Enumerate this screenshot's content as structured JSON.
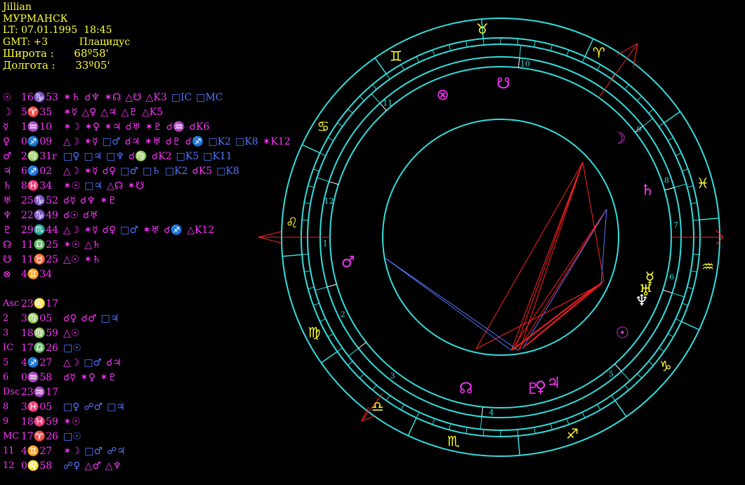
{
  "header": {
    "name": "Jillian",
    "city": "МУРМАНСК",
    "local_time": "LT: 07.01.1995  18:45",
    "gmt": "GMT: +3",
    "house_system": "Плацидус",
    "latitude_label": "Широта :",
    "latitude_value": "68º58'",
    "longitude_label": "Долгота :",
    "longitude_value": "33º05'"
  },
  "colors": {
    "yellow": "#ffff33",
    "magenta": "#ff33ff",
    "cyan": "#33dddd",
    "blue": "#5577ff",
    "red": "#ff2222",
    "white": "#ffffff"
  },
  "planets": [
    {
      "symbol": "☉",
      "position": "16♑53",
      "aspects": [
        {
          "t": "✶♄",
          "c": "#ff33ff"
        },
        {
          "t": "☌♆",
          "c": "#ff33ff"
        },
        {
          "t": "✶☊",
          "c": "#ff33ff"
        },
        {
          "t": "△☋",
          "c": "#ff33ff"
        },
        {
          "t": "△K3",
          "c": "#ff33ff"
        },
        {
          "t": "□IC",
          "c": "#5577ff"
        },
        {
          "t": "□MC",
          "c": "#5577ff"
        }
      ]
    },
    {
      "symbol": "☽",
      "position": "5♈35",
      "aspects": [
        {
          "t": "✶☿",
          "c": "#ff33ff"
        },
        {
          "t": "△♀",
          "c": "#ff33ff"
        },
        {
          "t": "△♃",
          "c": "#ff33ff"
        },
        {
          "t": "△♇",
          "c": "#ff33ff"
        },
        {
          "t": "△K5",
          "c": "#ff33ff"
        }
      ]
    },
    {
      "symbol": "☿",
      "position": "1♒10",
      "aspects": [
        {
          "t": "✶☽",
          "c": "#ff33ff"
        },
        {
          "t": "✶♀",
          "c": "#ff33ff"
        },
        {
          "t": "✶♃",
          "c": "#ff33ff"
        },
        {
          "t": "☌♅",
          "c": "#ff33ff"
        },
        {
          "t": "✶♇",
          "c": "#ff33ff"
        },
        {
          "t": "☌♒",
          "c": "#ff33ff"
        },
        {
          "t": "☌K6",
          "c": "#ff33ff"
        }
      ]
    },
    {
      "symbol": "♀",
      "position": "0♐09",
      "aspects": [
        {
          "t": "△☽",
          "c": "#ff33ff"
        },
        {
          "t": "✶☿",
          "c": "#ff33ff"
        },
        {
          "t": "□♂",
          "c": "#5577ff"
        },
        {
          "t": "☌♃",
          "c": "#ff33ff"
        },
        {
          "t": "✶♅",
          "c": "#ff33ff"
        },
        {
          "t": "☌♇",
          "c": "#ff33ff"
        },
        {
          "t": "☌♐",
          "c": "#ff33ff"
        },
        {
          "t": "□K2",
          "c": "#5577ff"
        },
        {
          "t": "□K8",
          "c": "#5577ff"
        },
        {
          "t": "✶K12",
          "c": "#ff33ff"
        }
      ]
    },
    {
      "symbol": "♂",
      "position": "2♍31r",
      "aspects": [
        {
          "t": "□♀",
          "c": "#5577ff"
        },
        {
          "t": "□♃",
          "c": "#5577ff"
        },
        {
          "t": "□♆",
          "c": "#5577ff"
        },
        {
          "t": "☌♍",
          "c": "#ff33ff"
        },
        {
          "t": "☌K2",
          "c": "#ff33ff"
        },
        {
          "t": "□K5",
          "c": "#5577ff"
        },
        {
          "t": "□K11",
          "c": "#5577ff"
        }
      ]
    },
    {
      "symbol": "♃",
      "position": "6♐02",
      "aspects": [
        {
          "t": "△☽",
          "c": "#ff33ff"
        },
        {
          "t": "✶☿",
          "c": "#ff33ff"
        },
        {
          "t": "☌♀",
          "c": "#ff33ff"
        },
        {
          "t": "□♂",
          "c": "#5577ff"
        },
        {
          "t": "□♄",
          "c": "#5577ff"
        },
        {
          "t": "□K2",
          "c": "#5577ff"
        },
        {
          "t": "☌K5",
          "c": "#ff33ff"
        },
        {
          "t": "□K8",
          "c": "#5577ff"
        }
      ]
    },
    {
      "symbol": "♄",
      "position": "8♓34",
      "aspects": [
        {
          "t": "✶☉",
          "c": "#ff33ff"
        },
        {
          "t": "□♃",
          "c": "#5577ff"
        },
        {
          "t": "△☊",
          "c": "#ff33ff"
        },
        {
          "t": "✶☋",
          "c": "#ff33ff"
        }
      ]
    },
    {
      "symbol": "♅",
      "position": "25♑52",
      "aspects": [
        {
          "t": "☌☿",
          "c": "#ff33ff"
        },
        {
          "t": "☌♆",
          "c": "#ff33ff"
        },
        {
          "t": "✶♇",
          "c": "#ff33ff"
        }
      ]
    },
    {
      "symbol": "♆",
      "position": "22♑49",
      "aspects": [
        {
          "t": "☌☉",
          "c": "#ff33ff"
        },
        {
          "t": "☌♅",
          "c": "#ff33ff"
        }
      ]
    },
    {
      "symbol": "♇",
      "position": "29♏44",
      "aspects": [
        {
          "t": "△☽",
          "c": "#ff33ff"
        },
        {
          "t": "✶☿",
          "c": "#ff33ff"
        },
        {
          "t": "☌♀",
          "c": "#ff33ff"
        },
        {
          "t": "□♂",
          "c": "#5577ff"
        },
        {
          "t": "✶♅",
          "c": "#ff33ff"
        },
        {
          "t": "☌♐",
          "c": "#ff33ff"
        },
        {
          "t": "△K12",
          "c": "#ff33ff"
        }
      ]
    },
    {
      "symbol": "☊",
      "position": "11♎25",
      "aspects": [
        {
          "t": "✶☉",
          "c": "#ff33ff"
        },
        {
          "t": "△♄",
          "c": "#ff33ff"
        }
      ]
    },
    {
      "symbol": "☋",
      "position": "11♉25",
      "aspects": [
        {
          "t": "△☉",
          "c": "#ff33ff"
        },
        {
          "t": "✶♄",
          "c": "#ff33ff"
        }
      ]
    },
    {
      "symbol": "⊗",
      "position": "4♊34",
      "aspects": []
    }
  ],
  "houses": [
    {
      "label": "Asc",
      "position": "23♌17",
      "aspects": []
    },
    {
      "label": "2",
      "position": "3♍05",
      "aspects": [
        {
          "t": "☌♀",
          "c": "#ff33ff"
        },
        {
          "t": "☌♂",
          "c": "#ff33ff"
        },
        {
          "t": "□♃",
          "c": "#5577ff"
        }
      ]
    },
    {
      "label": "3",
      "position": "18♍59",
      "aspects": [
        {
          "t": "△☉",
          "c": "#ff33ff"
        }
      ]
    },
    {
      "label": "IC",
      "position": "17♎26",
      "aspects": [
        {
          "t": "□☉",
          "c": "#5577ff"
        }
      ]
    },
    {
      "label": "5",
      "position": "4♐27",
      "aspects": [
        {
          "t": "△☽",
          "c": "#ff33ff"
        },
        {
          "t": "□♂",
          "c": "#5577ff"
        },
        {
          "t": "☌♃",
          "c": "#ff33ff"
        }
      ]
    },
    {
      "label": "6",
      "position": "0♒58",
      "aspects": [
        {
          "t": "☌☿",
          "c": "#ff33ff"
        },
        {
          "t": "✶♀",
          "c": "#ff33ff"
        },
        {
          "t": "✶♇",
          "c": "#ff33ff"
        }
      ]
    },
    {
      "label": "Dsc",
      "position": "23♒17",
      "aspects": []
    },
    {
      "label": "8",
      "position": "3♓05",
      "aspects": [
        {
          "t": "□♀",
          "c": "#5577ff"
        },
        {
          "t": "☍♂",
          "c": "#5577ff"
        },
        {
          "t": "□♃",
          "c": "#5577ff"
        }
      ]
    },
    {
      "label": "9",
      "position": "18♓59",
      "aspects": [
        {
          "t": "✶☉",
          "c": "#ff33ff"
        }
      ]
    },
    {
      "label": "MC",
      "position": "17♈26",
      "aspects": [
        {
          "t": "□☉",
          "c": "#5577ff"
        }
      ]
    },
    {
      "label": "11",
      "position": "4♊27",
      "aspects": [
        {
          "t": "✶☽",
          "c": "#ff33ff"
        },
        {
          "t": "□♂",
          "c": "#5577ff"
        },
        {
          "t": "☍♃",
          "c": "#5577ff"
        }
      ]
    },
    {
      "label": "12",
      "position": "0♌58",
      "aspects": [
        {
          "t": "☍♀",
          "c": "#5577ff"
        },
        {
          "t": "△♂",
          "c": "#ff33ff"
        },
        {
          "t": "△♆",
          "c": "#ff33ff"
        }
      ]
    }
  ],
  "wheel": {
    "signs": [
      {
        "glyph": "♉",
        "angle": 95
      },
      {
        "glyph": "♊",
        "angle": 120
      },
      {
        "glyph": "♋",
        "angle": 148
      },
      {
        "glyph": "♌",
        "angle": 176
      },
      {
        "glyph": "♍",
        "angle": 207
      },
      {
        "glyph": "♎",
        "angle": 234
      },
      {
        "glyph": "♏",
        "angle": 257
      },
      {
        "glyph": "♐",
        "angle": 290
      },
      {
        "glyph": "♑",
        "angle": 322
      },
      {
        "glyph": "♒",
        "angle": 352
      },
      {
        "glyph": "♓",
        "angle": 15
      },
      {
        "glyph": "♈",
        "angle": 62
      }
    ],
    "house_numbers": [
      {
        "n": "1",
        "angle": 182
      },
      {
        "n": "2",
        "angle": 206
      },
      {
        "n": "3",
        "angle": 232
      },
      {
        "n": "4",
        "angle": 267
      },
      {
        "n": "5",
        "angle": 309
      },
      {
        "n": "6",
        "angle": 347
      },
      {
        "n": "7",
        "angle": 4
      },
      {
        "n": "8",
        "angle": 19
      },
      {
        "n": "9",
        "angle": 38
      },
      {
        "n": "10",
        "angle": 82
      },
      {
        "n": "11",
        "angle": 130
      },
      {
        "n": "12",
        "angle": 168
      }
    ],
    "planets": [
      {
        "glyph": "⊗",
        "angle": 112,
        "color": "#ff33ff"
      },
      {
        "glyph": "☋",
        "angle": 89,
        "color": "#ff33ff"
      },
      {
        "glyph": "☽",
        "angle": 40,
        "color": "#ff33ff"
      },
      {
        "glyph": "♄",
        "angle": 18,
        "color": "#ff33ff"
      },
      {
        "glyph": "♂",
        "angle": 189,
        "color": "#ff33ff"
      },
      {
        "glyph": "☊",
        "angle": 257,
        "color": "#ff33ff"
      },
      {
        "glyph": "♇",
        "angle": 282,
        "color": "#ff33ff"
      },
      {
        "glyph": "♀",
        "angle": 285,
        "color": "#ff33ff"
      },
      {
        "glyph": "♃",
        "angle": 290,
        "color": "#ff33ff"
      },
      {
        "glyph": "♆",
        "angle": 336,
        "color": "#ffffff"
      },
      {
        "glyph": "♅",
        "angle": 340,
        "color": "#ffff33"
      },
      {
        "glyph": "☿",
        "angle": 345,
        "color": "#ffff33"
      },
      {
        "glyph": "☉",
        "angle": 322,
        "color": "#ff33ff"
      }
    ]
  }
}
